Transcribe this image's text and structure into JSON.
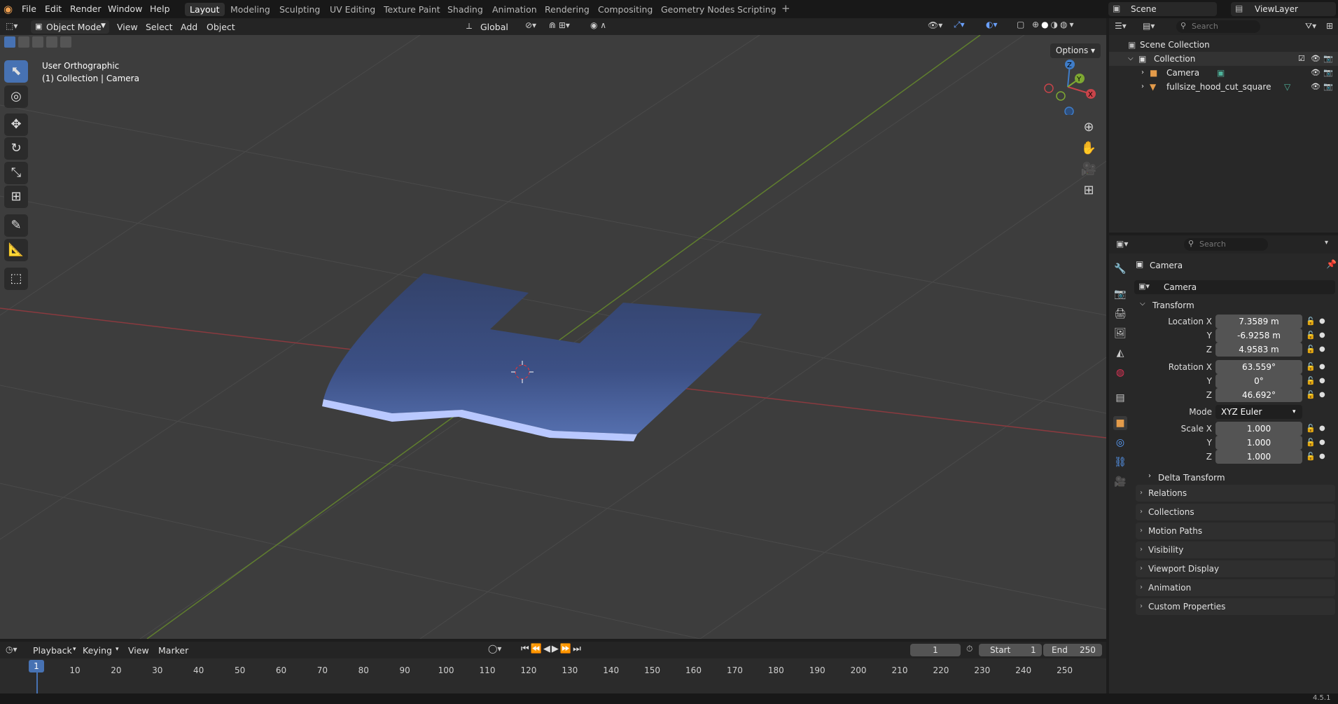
{
  "menu": {
    "file": "File",
    "edit": "Edit",
    "render": "Render",
    "window": "Window",
    "help": "Help"
  },
  "workspaces": [
    "Layout",
    "Modeling",
    "Sculpting",
    "UV Editing",
    "Texture Paint",
    "Shading",
    "Animation",
    "Rendering",
    "Compositing",
    "Geometry Nodes",
    "Scripting"
  ],
  "scene": {
    "name": "Scene",
    "view_layer": "ViewLayer"
  },
  "viewport_header": {
    "mode": "Object Mode",
    "view": "View",
    "select": "Select",
    "add": "Add",
    "object": "Object",
    "orientation": "Global",
    "options": "Options"
  },
  "viewport_overlay": {
    "view_name": "User Orthographic",
    "context": "(1) Collection | Camera"
  },
  "gizmo": {
    "x": "X",
    "y": "Y",
    "z": "Z"
  },
  "outliner": {
    "search_placeholder": "Search",
    "root": "Scene Collection",
    "collection": "Collection",
    "items": [
      "Camera",
      "fullsize_hood_cut_square"
    ]
  },
  "properties": {
    "search_placeholder": "Search",
    "object_name": "Camera",
    "data_name": "Camera",
    "transform_title": "Transform",
    "location_label": "Location X",
    "loc_x": "7.3589 m",
    "loc_y": "-6.9258 m",
    "loc_z": "4.9583 m",
    "rotation_label": "Rotation X",
    "rot_x": "63.559°",
    "rot_y": "0°",
    "rot_z": "46.692°",
    "mode_label": "Mode",
    "mode_value": "XYZ Euler",
    "scale_label": "Scale X",
    "scale_x": "1.000",
    "scale_y": "1.000",
    "scale_z": "1.000",
    "y_label": "Y",
    "z_label": "Z",
    "delta": "Delta Transform",
    "panels": [
      "Relations",
      "Collections",
      "Motion Paths",
      "Visibility",
      "Viewport Display",
      "Animation",
      "Custom Properties"
    ]
  },
  "timeline": {
    "playback": "Playback",
    "keying": "Keying",
    "view": "View",
    "marker": "Marker",
    "current_frame": "1",
    "start_label": "Start",
    "start": "1",
    "end_label": "End",
    "end": "250",
    "ticks": [
      "10",
      "20",
      "30",
      "40",
      "50",
      "60",
      "70",
      "80",
      "90",
      "100",
      "110",
      "120",
      "130",
      "140",
      "150",
      "160",
      "170",
      "180",
      "190",
      "200",
      "210",
      "220",
      "230",
      "240",
      "250"
    ]
  },
  "status": {
    "version": "4.5.1"
  },
  "colors": {
    "accent": "#4772b3",
    "hood": "#3a4f80",
    "x_axis": "#b8393f",
    "y_axis": "#6e9a2e"
  }
}
